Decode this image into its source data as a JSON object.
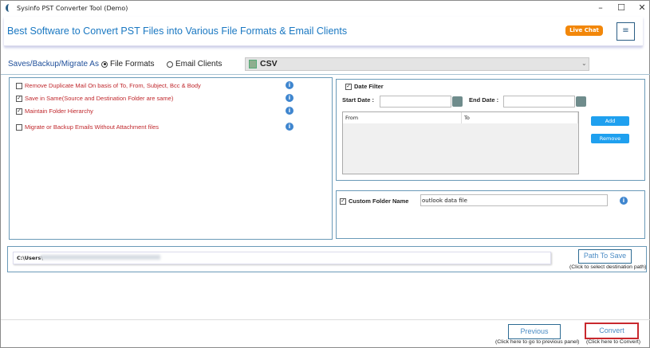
{
  "window": {
    "title": "Sysinfo PST Converter Tool (Demo)",
    "minimize": "–",
    "maximize": "☐",
    "close": "✕"
  },
  "header": {
    "title": "Best Software to Convert PST Files into Various File Formats & Email Clients",
    "live_chat": "Live Chat",
    "menu": "≡"
  },
  "save_as": {
    "label": "Saves/Backup/Migrate As",
    "options": [
      "File Formats",
      "Email Clients"
    ],
    "selected": "File Formats",
    "format": "CSV"
  },
  "options": [
    {
      "label": "Remove Duplicate Mail On basis of To, From, Subject, Bcc & Body",
      "checked": false
    },
    {
      "label": "Save in Same(Source and Destination Folder are same)",
      "checked": true
    },
    {
      "label": "Maintain Folder Hierarchy",
      "checked": true
    },
    {
      "label": "Migrate or Backup Emails Without Attachment files",
      "checked": false
    }
  ],
  "date_filter": {
    "label": "Date Filter",
    "checked": true,
    "start_label": "Start Date :",
    "end_label": "End Date :",
    "start_value": "",
    "end_value": "",
    "columns": [
      "From",
      "To"
    ],
    "add": "Add",
    "remove": "Remove"
  },
  "custom_folder": {
    "label": "Custom Folder Name",
    "checked": true,
    "value": "outlook data file"
  },
  "path": {
    "value": "C:\\Users\\",
    "button": "Path To Save",
    "caption": "(Click to select destination path)"
  },
  "footer": {
    "previous": "Previous",
    "previous_caption": "(Click here to go to previous panel)",
    "convert": "Convert",
    "convert_caption": "(Click here to Convert)"
  }
}
